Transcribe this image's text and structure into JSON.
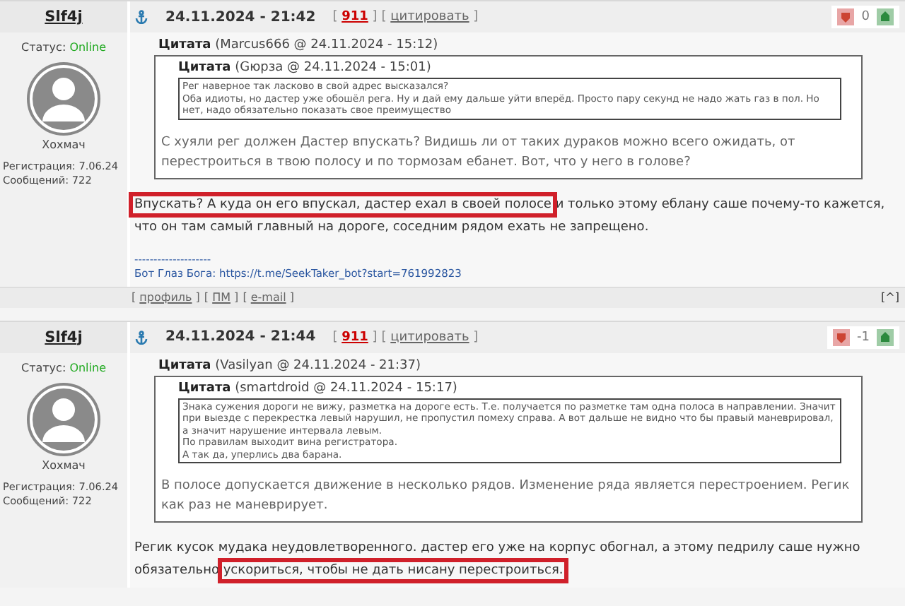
{
  "posts": [
    {
      "author": "Slf4j",
      "date": "24.11.2024 - 21:42",
      "links": [
        {
          "prefix": "[",
          "label": "911",
          "suffix": "]",
          "kind": "rating"
        },
        {
          "prefix": "[",
          "label": "цитировать",
          "suffix": "]",
          "kind": "plain"
        }
      ],
      "score": "0",
      "status_label": "Статус:",
      "status": "Online",
      "rank": "Хохмач",
      "registration": "Регистрация: 7.06.24",
      "messages": "Сообщений: 722",
      "quote": {
        "label": "Цитата",
        "meta": "(Marcus666 @ 24.11.2024 - 15:12)",
        "inner": {
          "label": "Цитата",
          "meta": "(Gюрза @ 24.11.2024 - 15:01)",
          "lines": [
            "Рег наверное так ласково в свой адрес высказался?",
            "Оба идиоты, но дастер уже обошёл рега. Ну и дай ему дальше уйти вперёд. Просто пару секунд не надо жать газ в пол. Но нет,  надо обязательно показать свое преимущество"
          ]
        },
        "text": "С хуяли рег должен Дастер впускать? Видишь ли от таких дураков можно всего ожидать, от перестроиться в твою полосу и по тормозам ебанет. Вот, что у него в голове?"
      },
      "reply": [
        {
          "text": "Впускать? А куда он его впускал, дастер ехал в своей полосе",
          "highlighted": true
        },
        {
          "text": " и только этому еблану саше почему-то кажется, что он там самый главный на дороге, соседним рядом ехать не запрещено.",
          "highlighted": false
        }
      ],
      "signature": {
        "rule": "--------------------",
        "text": "Бот Глаз Бога: https://t.me/SeekTaker_bot?start=761992823"
      },
      "footer": {
        "links": [
          {
            "prefix": "[",
            "label": "профиль",
            "suffix": "]"
          },
          {
            "prefix": "[",
            "label": "ПМ",
            "suffix": "]"
          },
          {
            "prefix": "[",
            "label": "e-mail",
            "suffix": "]"
          }
        ],
        "top": "[^]"
      }
    },
    {
      "author": "Slf4j",
      "date": "24.11.2024 - 21:44",
      "links": [
        {
          "prefix": "[",
          "label": "911",
          "suffix": "]",
          "kind": "rating"
        },
        {
          "prefix": "[",
          "label": "цитировать",
          "suffix": "]",
          "kind": "plain"
        }
      ],
      "score": "-1",
      "status_label": "Статус:",
      "status": "Online",
      "rank": "Хохмач",
      "registration": "Регистрация: 7.06.24",
      "messages": "Сообщений: 722",
      "quote": {
        "label": "Цитата",
        "meta": "(Vasilyan @ 24.11.2024 - 21:37)",
        "inner": {
          "label": "Цитата",
          "meta": "(smartdroid @ 24.11.2024 - 15:17)",
          "lines": [
            "Знака сужения дороги не вижу, разметка на дороге есть. Т.е. получается по разметке там одна полоса в направлении. Значит при выезде с перекрестка левый нарушил, не пропустил помеху справа. А вот дальше не видно что бы правый маневрировал, а значит нарушение интервала левым.",
            "По правилам выходит вина регистратора.",
            "А так да, уперлись два барана."
          ]
        },
        "text": "В полосе допускается движение в несколько рядов. Изменение ряда является перестроением. Регик как раз не маневрирует."
      },
      "reply": [
        {
          "text": "Регик кусок мудака неудовлетворенного. дастер его уже на корпус обогнал, а этому педрилу саше нужно обязательно ",
          "highlighted": false
        },
        {
          "text": "ускориться, чтобы не дать нисану перестроиться.",
          "highlighted": true
        }
      ]
    }
  ]
}
